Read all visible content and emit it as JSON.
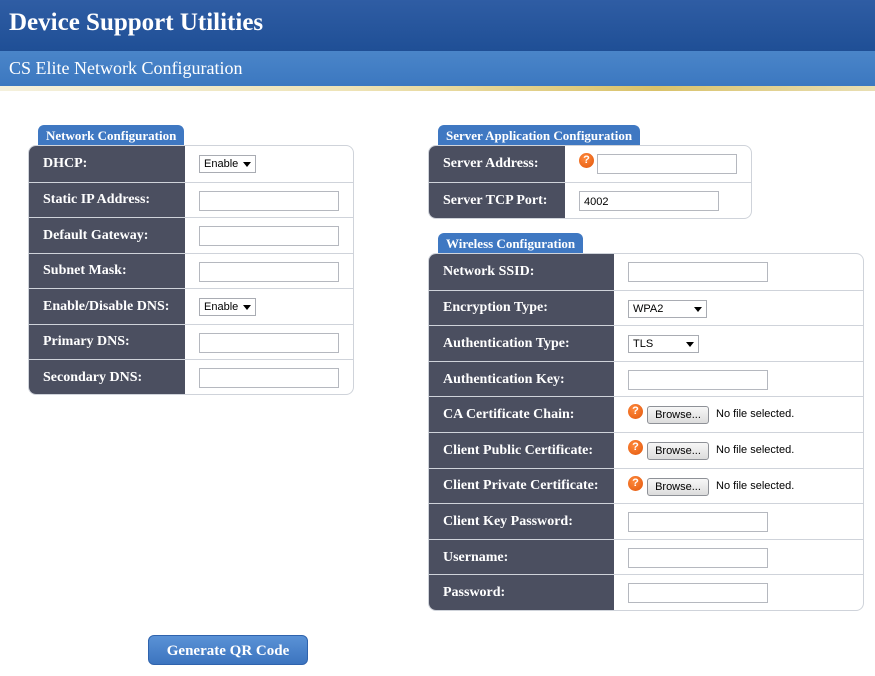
{
  "header": {
    "title": "Device Support Utilities",
    "subtitle": "CS Elite Network Configuration"
  },
  "network": {
    "tab": "Network Configuration",
    "rows": [
      {
        "label": "DHCP:",
        "type": "select",
        "value": "Enable"
      },
      {
        "label": "Static IP Address:",
        "type": "text",
        "value": ""
      },
      {
        "label": "Default Gateway:",
        "type": "text",
        "value": ""
      },
      {
        "label": "Subnet Mask:",
        "type": "text",
        "value": ""
      },
      {
        "label": "Enable/Disable DNS:",
        "type": "select",
        "value": "Enable"
      },
      {
        "label": "Primary DNS:",
        "type": "text",
        "value": ""
      },
      {
        "label": "Secondary DNS:",
        "type": "text",
        "value": ""
      }
    ]
  },
  "server": {
    "tab": "Server Application Configuration",
    "rows": [
      {
        "label": "Server Address:",
        "type": "text",
        "value": "",
        "help": true
      },
      {
        "label": "Server TCP Port:",
        "type": "text",
        "value": "4002"
      }
    ]
  },
  "wireless": {
    "tab": "Wireless Configuration",
    "rows": [
      {
        "label": "Network SSID:",
        "type": "text",
        "value": ""
      },
      {
        "label": "Encryption Type:",
        "type": "select",
        "value": "WPA2"
      },
      {
        "label": "Authentication Type:",
        "type": "select",
        "value": "TLS"
      },
      {
        "label": "Authentication Key:",
        "type": "text",
        "value": ""
      },
      {
        "label": "CA Certificate Chain:",
        "type": "file",
        "button": "Browse...",
        "status": "No file selected.",
        "help": true
      },
      {
        "label": "Client Public Certificate:",
        "type": "file",
        "button": "Browse...",
        "status": "No file selected.",
        "help": true
      },
      {
        "label": "Client Private Certificate:",
        "type": "file",
        "button": "Browse...",
        "status": "No file selected.",
        "help": true
      },
      {
        "label": "Client Key Password:",
        "type": "text",
        "value": ""
      },
      {
        "label": "Username:",
        "type": "text",
        "value": ""
      },
      {
        "label": "Password:",
        "type": "text",
        "value": ""
      }
    ]
  },
  "actions": {
    "generate_qr": "Generate QR Code"
  },
  "help_glyph": "?",
  "colors": {
    "header": "#2f5da4",
    "subheader": "#4a85c9",
    "label_bg": "#4b4f60",
    "tab": "#3f78c2",
    "help": "#e2560b"
  }
}
